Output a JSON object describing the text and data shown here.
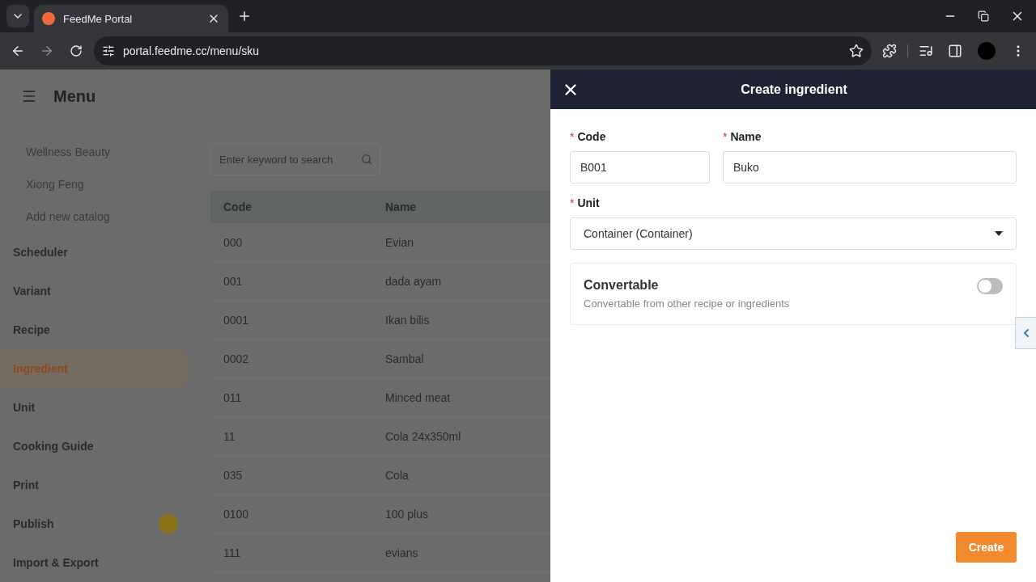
{
  "browser": {
    "tab_title": "FeedMe Portal",
    "url": "portal.feedme.cc/menu/sku"
  },
  "page": {
    "title": "Menu",
    "search": {
      "placeholder": "Enter keyword to search"
    },
    "sidebar": {
      "items": [
        {
          "label": "Wellness Beauty",
          "kind": "sub",
          "selected": false
        },
        {
          "label": "Xiong Feng",
          "kind": "sub",
          "selected": false
        },
        {
          "label": "Add new catalog",
          "kind": "sub",
          "selected": false
        },
        {
          "label": "Scheduler",
          "kind": "main",
          "selected": false
        },
        {
          "label": "Variant",
          "kind": "main",
          "selected": false
        },
        {
          "label": "Recipe",
          "kind": "main",
          "selected": false
        },
        {
          "label": "Ingredient",
          "kind": "main",
          "selected": true
        },
        {
          "label": "Unit",
          "kind": "main",
          "selected": false
        },
        {
          "label": "Cooking Guide",
          "kind": "main",
          "selected": false
        },
        {
          "label": "Print",
          "kind": "main",
          "selected": false
        },
        {
          "label": "Publish",
          "kind": "main",
          "selected": false,
          "badge": true
        },
        {
          "label": "Import & Export",
          "kind": "main",
          "selected": false
        }
      ]
    },
    "table": {
      "columns": [
        "Code",
        "Name"
      ],
      "rows": [
        [
          "000",
          "Evian"
        ],
        [
          "001",
          "dada ayam"
        ],
        [
          "0001",
          "Ikan bilis"
        ],
        [
          "0002",
          "Sambal"
        ],
        [
          "011",
          "Minced meat"
        ],
        [
          "11",
          "Cola 24x350ml"
        ],
        [
          "035",
          "Cola"
        ],
        [
          "0100",
          "100 plus"
        ],
        [
          "111",
          "evians"
        ]
      ]
    }
  },
  "drawer": {
    "title": "Create ingredient",
    "fields": [
      {
        "label": "Code",
        "marker": "*",
        "value": "B001"
      },
      {
        "label": "Name",
        "marker": "*",
        "value": "Buko"
      }
    ],
    "unit": {
      "label": "Unit",
      "marker": "*",
      "value": "Container (Container)"
    },
    "convertable": {
      "title": "Convertable",
      "description": "Convertable from other recipe or ingredients",
      "on": false
    },
    "submit": "Create"
  }
}
